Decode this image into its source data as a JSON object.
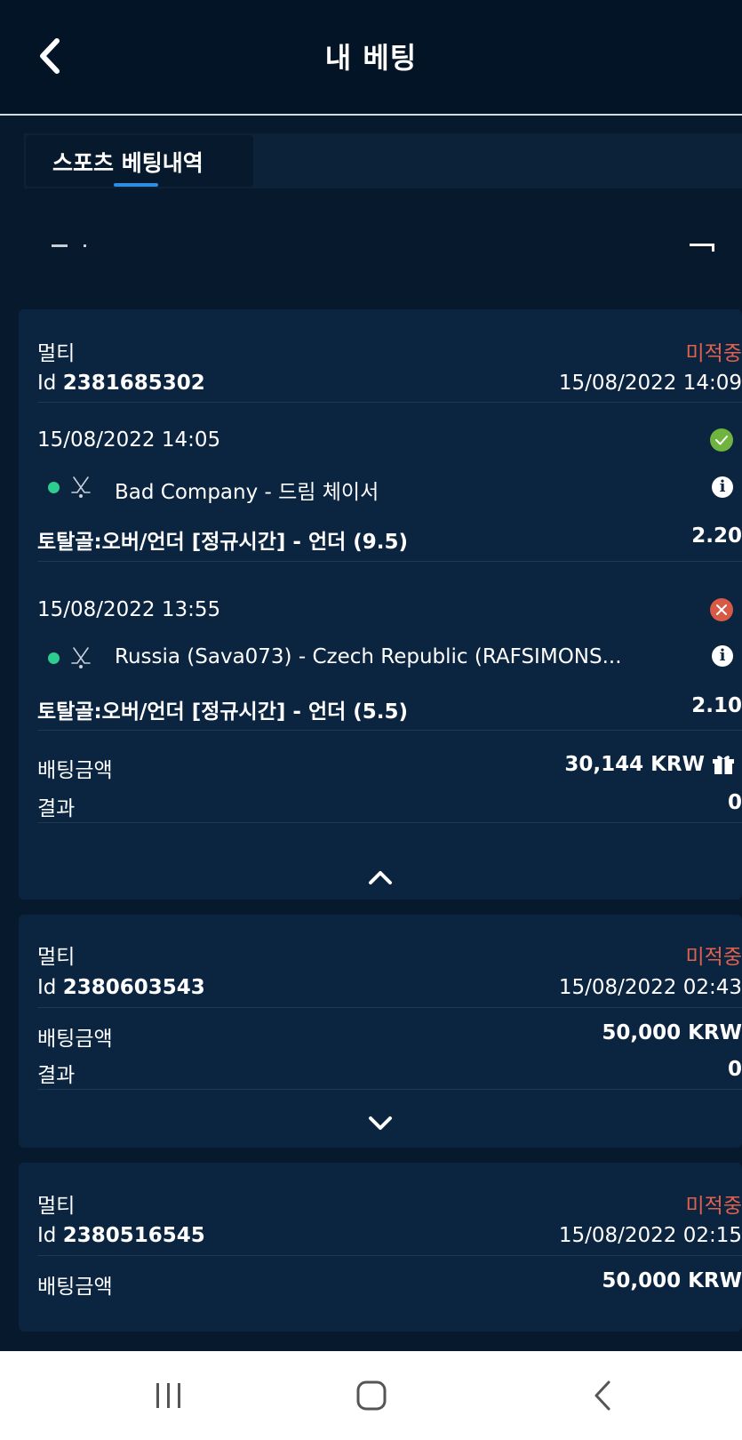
{
  "header": {
    "title": "내 베팅",
    "back_icon": "chevron-left-icon"
  },
  "tabs": [
    {
      "label": "스포츠 베팅내역",
      "active": true
    }
  ],
  "colors": {
    "background": "#07192d",
    "card": "#0b2440",
    "status_pending": "#e0614c",
    "win": "#6fb43f",
    "loss": "#d85a46",
    "accent": "#2f8de4",
    "live_dot": "#2ecc8f"
  },
  "bets": [
    {
      "type": "멀티",
      "status": "미적중",
      "id_label": "Id",
      "id": "2381685302",
      "datetime": "15/08/2022 14:09",
      "expanded": true,
      "selections": [
        {
          "datetime": "15/08/2022 14:05",
          "result_icon": "check-circle-icon",
          "sport_icon": "hockey-sticks-icon",
          "match": "Bad Company - 드림 체이서",
          "market": "토탈골:오버/언더 [정규시간] - 언더 (9.5)",
          "odds": "2.20"
        },
        {
          "datetime": "15/08/2022 13:55",
          "result_icon": "x-circle-icon",
          "sport_icon": "hockey-sticks-icon",
          "match": "Russia (Sava073) - Czech Republic (RAFSIMONS...",
          "market": "토탈골:오버/언더 [정규시간] - 언더 (5.5)",
          "odds": "2.10"
        }
      ],
      "stake_label": "배팅금액",
      "stake": "30,144 KRW",
      "stake_icon": "gift-icon",
      "result_label": "결과",
      "result": "0"
    },
    {
      "type": "멀티",
      "status": "미적중",
      "id_label": "Id",
      "id": "2380603543",
      "datetime": "15/08/2022 02:43",
      "expanded": false,
      "stake_label": "배팅금액",
      "stake": "50,000 KRW",
      "result_label": "결과",
      "result": "0"
    },
    {
      "type": "멀티",
      "status": "미적중",
      "id_label": "Id",
      "id": "2380516545",
      "datetime": "15/08/2022 02:15",
      "stake_label": "배팅금액",
      "stake": "50,000 KRW"
    }
  ],
  "system_nav": {
    "recents_icon": "recents-icon",
    "home_icon": "home-icon",
    "back_icon": "back-icon"
  }
}
